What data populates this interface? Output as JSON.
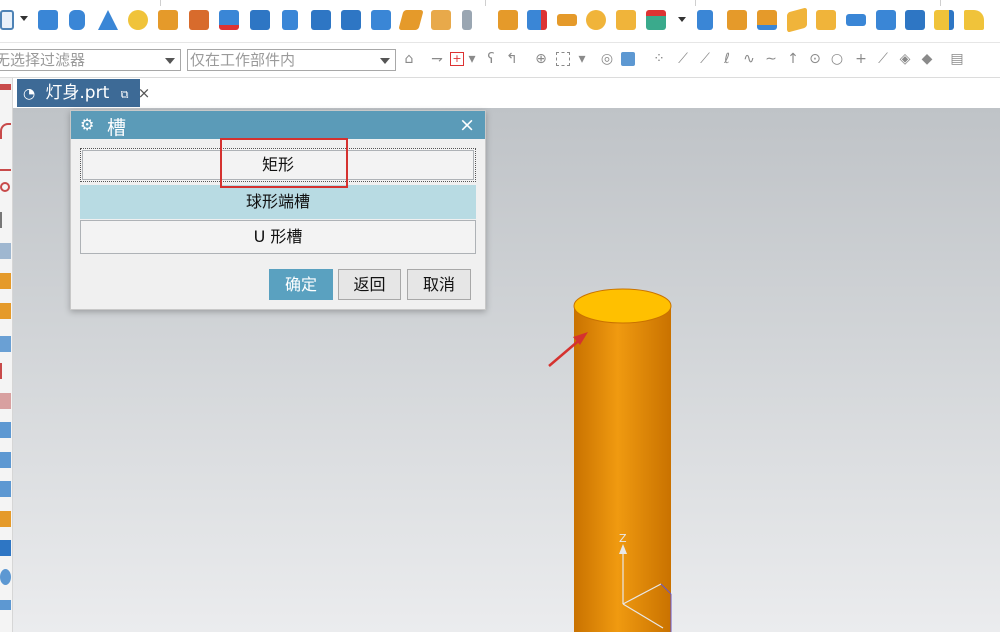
{
  "toolbar": {
    "filter_combo": {
      "value": "无选择过滤器"
    },
    "scope_combo": {
      "value": "仅在工作部件内"
    },
    "top_icons": [
      "rectangle-icon",
      "block-icon",
      "cylinder-icon",
      "cone-icon",
      "sphere-icon",
      "boss-icon",
      "pad-icon",
      "nx5-icon",
      "pocket-icon",
      "slot-icon",
      "groove-icon",
      "thread-icon",
      "extrude-icon",
      "revolve-icon",
      "hole-icon",
      "pattern-icon",
      "unite-icon",
      "subtract-icon",
      "intersect-icon",
      "chamfer-icon",
      "blend-icon",
      "draft-icon",
      "shell-icon",
      "offset-icon",
      "trim-icon",
      "move-icon"
    ]
  },
  "tab": {
    "label": "灯身.prt",
    "pin": "⧉",
    "close": "×"
  },
  "dialog": {
    "title": "槽",
    "close": "×",
    "options": [
      "矩形",
      "球形端槽",
      "U 形槽"
    ],
    "ok": "确定",
    "back": "返回",
    "cancel": "取消"
  },
  "viewport": {
    "axis_z": "Z"
  },
  "colors": {
    "cylinder_side": "#e08a00",
    "cylinder_top": "#ffc000",
    "dialog_title": "#5b9bb8",
    "highlight": "#d5322f",
    "tab_active": "#3d6a96"
  }
}
